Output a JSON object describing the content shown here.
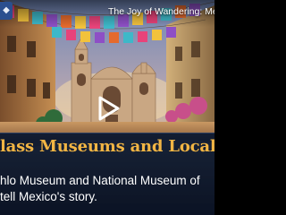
{
  "video": {
    "title": "The Joy of Wandering: Mexico's Enc",
    "channel_icon": "channel-logo-icon",
    "play_icon": "play-icon"
  },
  "caption": {
    "heading": "lass Museums and Local",
    "body_line_1": "hlo Museum and National Museum of",
    "body_line_2": "tell Mexico's story."
  },
  "colors": {
    "heading": "#f2b544",
    "panel": "#081630",
    "text": "#ffffff"
  }
}
